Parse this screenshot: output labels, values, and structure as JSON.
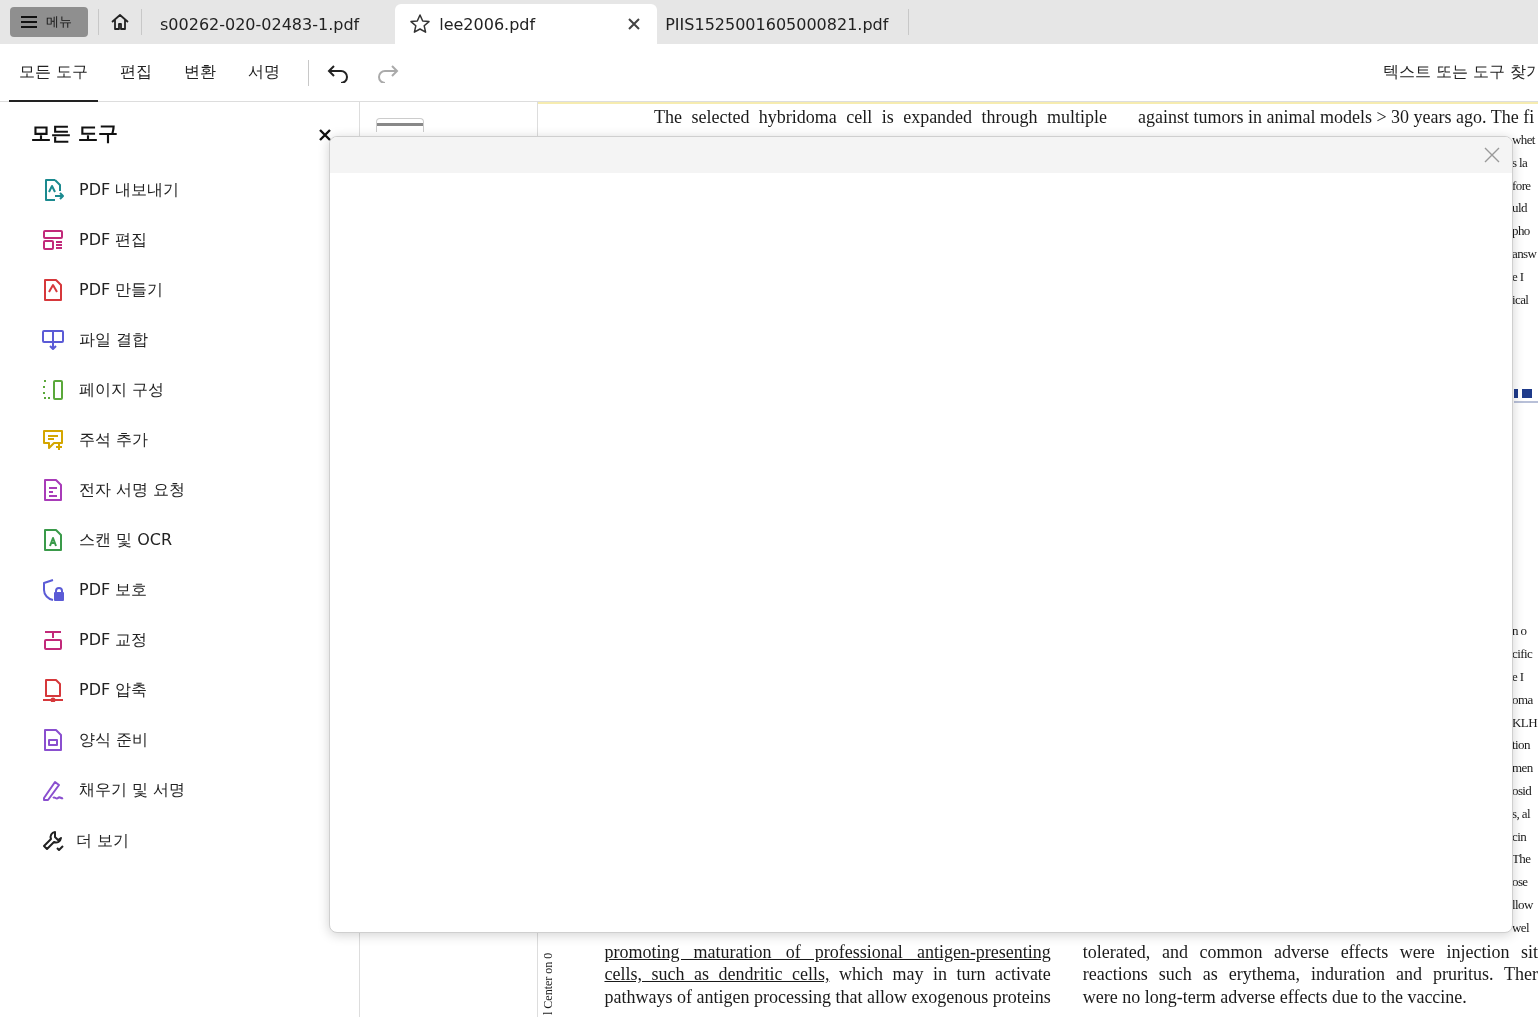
{
  "tab_bar": {
    "menu_button": "메뉴",
    "tabs": [
      {
        "title": "s00262-020-02483-1.pdf",
        "selected": false
      },
      {
        "title": "lee2006.pdf",
        "selected": true
      },
      {
        "title": "PIIS1525001605000821.pdf",
        "selected": false
      }
    ]
  },
  "toolbar": {
    "items": [
      {
        "label": "모든 도구",
        "selected": true
      },
      {
        "label": "편집",
        "selected": false
      },
      {
        "label": "변환",
        "selected": false
      },
      {
        "label": "서명",
        "selected": false
      }
    ],
    "undo": {
      "disabled": false
    },
    "redo": {
      "disabled": true
    },
    "search": "텍스트 또는 도구 찾기"
  },
  "tools_panel": {
    "title": "모든 도구",
    "items": [
      {
        "label": "PDF 내보내기",
        "kind": "export",
        "color": "#1b8a8f"
      },
      {
        "label": "PDF 편집",
        "kind": "edit",
        "color": "#c2297a"
      },
      {
        "label": "PDF 만들기",
        "kind": "create",
        "color": "#d6383b"
      },
      {
        "label": "파일 결합",
        "kind": "combine",
        "color": "#5b5bd6"
      },
      {
        "label": "페이지 구성",
        "kind": "organize",
        "color": "#5aa83a"
      },
      {
        "label": "주석 추가",
        "kind": "comment",
        "color": "#d4a600"
      },
      {
        "label": "전자 서명 요청",
        "kind": "esign",
        "color": "#a83bb8"
      },
      {
        "label": "스캔 및 OCR",
        "kind": "scan",
        "color": "#3a9a4a"
      },
      {
        "label": "PDF 보호",
        "kind": "protect",
        "color": "#5b5bd6"
      },
      {
        "label": "PDF 교정",
        "kind": "redact",
        "color": "#c2297a"
      },
      {
        "label": "PDF 압축",
        "kind": "compress",
        "color": "#d6383b"
      },
      {
        "label": "양식 준비",
        "kind": "form",
        "color": "#8a4fcf"
      },
      {
        "label": "채우기 및 서명",
        "kind": "fill-sign",
        "color": "#8a4fcf"
      },
      {
        "label": "더 보기",
        "kind": "more",
        "color": "#222222"
      }
    ]
  },
  "document": {
    "top_left": "The selected hybridoma cell is expanded through multiple",
    "top_right": "against tumors in animal models > 30 years ago. The fi",
    "right_fragments_upper": [
      "whet",
      "s la",
      "fore",
      "uld",
      "pho",
      "answ",
      "e I",
      "ical"
    ],
    "right_fragments_lower": [
      "n o",
      "cific",
      "e I",
      "oma",
      "KLH",
      "tion",
      "men",
      "osid",
      "s, al",
      "cin",
      "The",
      "ose",
      "llow",
      "wel"
    ],
    "side_text": "l Center on 0",
    "bottom_left": [
      {
        "parts": [
          {
            "text": "promoting maturation of professional antigen-presenting",
            "underlined": true
          }
        ]
      },
      {
        "parts": [
          {
            "text": "cells, such as dendritic cells,",
            "underlined": true
          },
          {
            "text": " which may in turn activate",
            "underlined": false
          }
        ]
      },
      {
        "parts": [
          {
            "text": "pathways of antigen processing that allow exogenous proteins",
            "underlined": false
          }
        ]
      }
    ],
    "bottom_right": [
      "tolerated, and common adverse effects were injection sit",
      "reactions such as erythema, induration and pruritus. Ther",
      "were no long-term adverse effects due to the vaccine."
    ]
  }
}
